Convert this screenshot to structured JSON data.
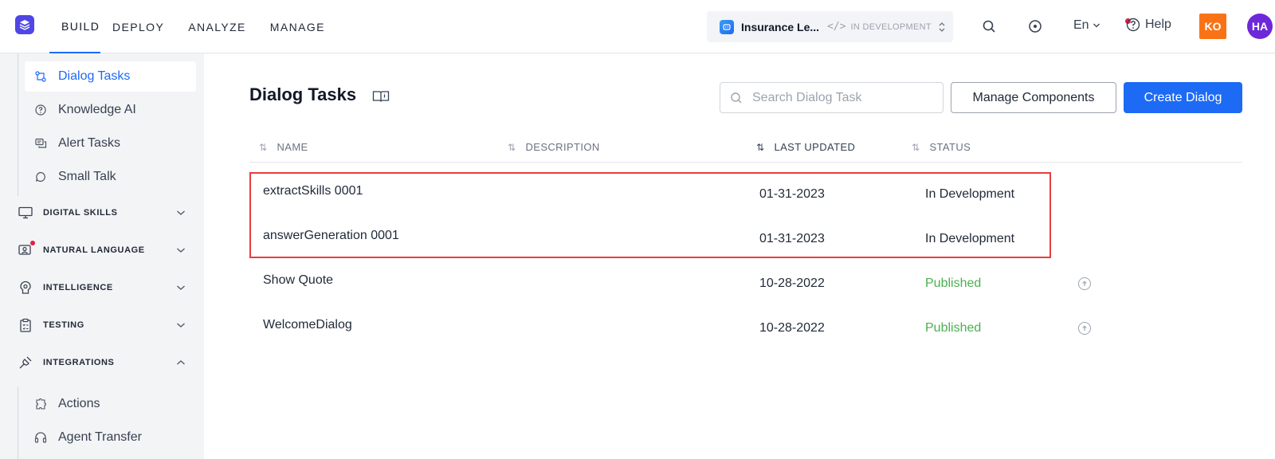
{
  "topbar": {
    "nav": [
      {
        "label": "BUILD",
        "active": true
      },
      {
        "label": "DEPLOY",
        "active": false
      },
      {
        "label": "ANALYZE",
        "active": false
      },
      {
        "label": "MANAGE",
        "active": false
      }
    ],
    "bot_name": "Insurance Le...",
    "bot_status": "IN DEVELOPMENT",
    "language": "En",
    "help_label": "Help",
    "user_initials_1": "KO",
    "user_initials_2": "HA",
    "colors": {
      "accent": "#1d6af5",
      "avatar_1": "#f97316",
      "avatar_2": "#6d28d9"
    }
  },
  "sidebar": {
    "sub_items": [
      {
        "label": "Dialog Tasks",
        "icon": "dialog-icon",
        "active": true
      },
      {
        "label": "Knowledge AI",
        "icon": "question-circle-icon",
        "active": false
      },
      {
        "label": "Alert Tasks",
        "icon": "alert-chat-icon",
        "active": false
      },
      {
        "label": "Small Talk",
        "icon": "chat-bubble-icon",
        "active": false
      }
    ],
    "groups": [
      {
        "label": "DIGITAL SKILLS",
        "icon": "monitor-icon",
        "expanded": false
      },
      {
        "label": "NATURAL LANGUAGE",
        "icon": "nlp-icon",
        "expanded": false,
        "badge": true
      },
      {
        "label": "INTELLIGENCE",
        "icon": "brain-icon",
        "expanded": false
      },
      {
        "label": "TESTING",
        "icon": "clipboard-icon",
        "expanded": false
      },
      {
        "label": "INTEGRATIONS",
        "icon": "plug-icon",
        "expanded": true
      }
    ],
    "integration_items": [
      {
        "label": "Actions",
        "icon": "puzzle-icon"
      },
      {
        "label": "Agent Transfer",
        "icon": "headset-icon"
      }
    ]
  },
  "main": {
    "title": "Dialog Tasks",
    "search_placeholder": "Search Dialog Task",
    "manage_button": "Manage Components",
    "create_button": "Create Dialog",
    "columns": [
      "NAME",
      "DESCRIPTION",
      "LAST UPDATED",
      "STATUS"
    ],
    "rows": [
      {
        "name": "extractSkills 0001",
        "description": "",
        "last_updated": "01-31-2023",
        "status": "In Development",
        "published": false
      },
      {
        "name": "answerGeneration 0001",
        "description": "",
        "last_updated": "01-31-2023",
        "status": "In Development",
        "published": false
      },
      {
        "name": "Show Quote",
        "description": "",
        "last_updated": "10-28-2022",
        "status": "Published",
        "published": true
      },
      {
        "name": "WelcomeDialog",
        "description": "",
        "last_updated": "10-28-2022",
        "status": "Published",
        "published": true
      }
    ],
    "colors": {
      "published": "#4caf50",
      "highlight": "#e53e3e"
    }
  }
}
